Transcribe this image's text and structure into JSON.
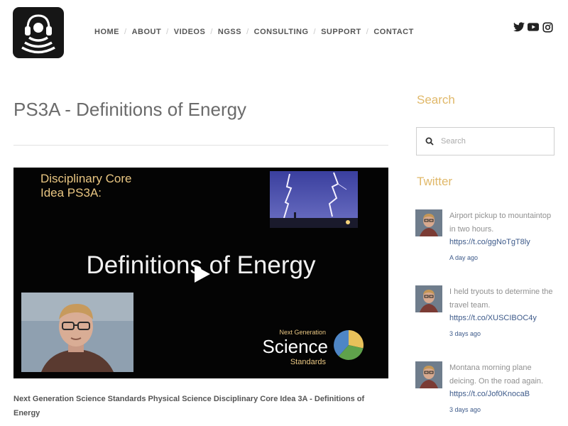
{
  "header": {
    "logo": "podcast-headphones-logo",
    "nav": [
      {
        "label": "HOME"
      },
      {
        "label": "ABOUT"
      },
      {
        "label": "VIDEOS"
      },
      {
        "label": "NGSS"
      },
      {
        "label": "CONSULTING"
      },
      {
        "label": "SUPPORT"
      },
      {
        "label": "CONTACT"
      }
    ],
    "social": [
      "twitter-icon",
      "youtube-icon",
      "instagram-icon"
    ]
  },
  "main": {
    "title": "PS3A - Definitions of Energy",
    "video": {
      "dci_line1": "Disciplinary Core",
      "dci_line2": "Idea PS3A:",
      "title": "Definitions of Energy",
      "ngss_small": "Next Generation",
      "ngss_big": "Science",
      "ngss_sub": "Standards"
    },
    "caption": "Next Generation Science Standards Physical Science Disciplinary Core Idea 3A - Definitions of Energy"
  },
  "sidebar": {
    "search_heading": "Search",
    "search_placeholder": "Search",
    "twitter_heading": "Twitter",
    "tweets": [
      {
        "text": "Airport pickup to mountaintop in two hours.",
        "link": "https://t.co/ggNoTgT8ly",
        "time": "A day ago"
      },
      {
        "text": "I held tryouts to determine the travel team.",
        "link": "https://t.co/XUSCIBOC4y",
        "time": "3 days ago"
      },
      {
        "text": "Montana morning plane deicing. On the road again.",
        "link": "https://t.co/Jof0KnocaB",
        "time": "3 days ago"
      }
    ]
  },
  "colors": {
    "accent": "#e0b869",
    "link": "#3d5a8a",
    "video_bg": "#040404"
  }
}
